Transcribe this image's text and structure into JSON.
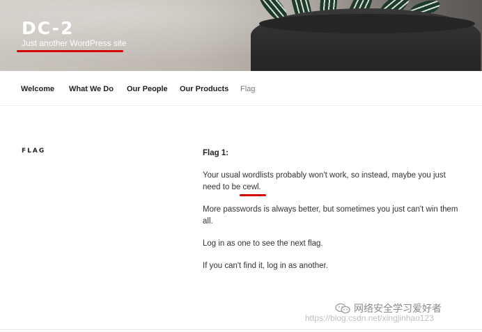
{
  "site": {
    "title": "DC-2",
    "description": "Just another WordPress site"
  },
  "nav": {
    "items": [
      {
        "label": "Welcome"
      },
      {
        "label": "What We Do"
      },
      {
        "label": "Our People"
      },
      {
        "label": "Our Products"
      },
      {
        "label": "Flag"
      }
    ]
  },
  "page": {
    "title": "FLAG",
    "heading": "Flag 1:",
    "paragraphs": [
      "Your usual wordlists probably won't work, so instead, maybe you just need to be cewl.",
      "More passwords is always better, but sometimes you just can't win them all.",
      "Log in as one to see the next flag.",
      "If you can't find it, log in as another."
    ]
  },
  "watermark": {
    "url_text": "https://blog.csdn.net/xingjinhao123",
    "wechat_text": "网络安全学习爱好者"
  },
  "colors": {
    "annotation_red": "#d40000",
    "nav_text": "#222222",
    "nav_current": "#767676"
  },
  "icons": [
    "wechat-icon"
  ]
}
